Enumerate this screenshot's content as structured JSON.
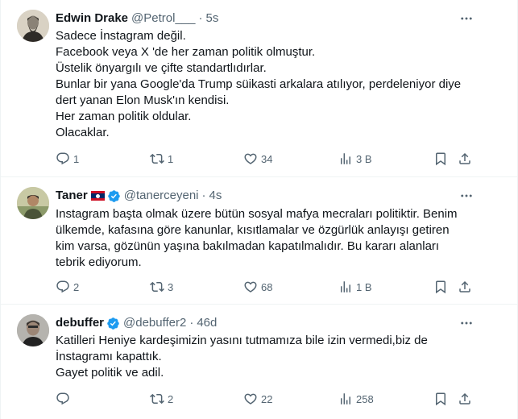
{
  "tweets": [
    {
      "name": "Edwin Drake",
      "handle": "@Petrol___",
      "time": "5s",
      "text": [
        "Sadece İnstagram değil.",
        "Facebook veya  X 'de her zaman politik olmuştur.",
        "Üstelik önyargılı ve çifte standartlıdırlar.",
        "Bunlar bir yana Google'da Trump süikasti arkalara atılıyor, perdeleniyor diye",
        "dert yanan Elon Musk'ın kendisi.",
        "Her zaman politik oldular.",
        "Olacaklar."
      ],
      "replies": "1",
      "reposts": "1",
      "likes": "34",
      "views": "3 B"
    },
    {
      "name": "Taner",
      "handle": "@tanerceyeni",
      "time": "4s",
      "text": [
        "Instagram başta olmak üzere bütün sosyal mafya mecraları politiktir. Benim",
        "ülkemde, kafasına göre kanunlar, kısıtlamalar ve özgürlük anlayışı getiren",
        "kim varsa, gözünün yaşına bakılmadan kapatılmalıdır. Bu kararı alanları",
        "tebrik ediyorum."
      ],
      "replies": "2",
      "reposts": "3",
      "likes": "68",
      "views": "1 B"
    },
    {
      "name": "debuffer",
      "handle": "@debuffer2",
      "time": "46d",
      "text": [
        "Katilleri Heniye kardeşimizin yasını tutmamıza bile izin vermedi,biz de",
        "İnstagramı kapattık.",
        "Gayet politik ve adil."
      ],
      "replies": "",
      "reposts": "2",
      "likes": "22",
      "views": "258"
    }
  ],
  "separator": "·",
  "colors": {
    "text": "#0f1419",
    "secondary": "#536471",
    "verified": "#1d9bf0",
    "border": "#eff3f4"
  },
  "icons": [
    "reply-icon",
    "repost-icon",
    "like-icon",
    "views-icon",
    "bookmark-icon",
    "share-icon",
    "more-icon",
    "verified-icon"
  ]
}
